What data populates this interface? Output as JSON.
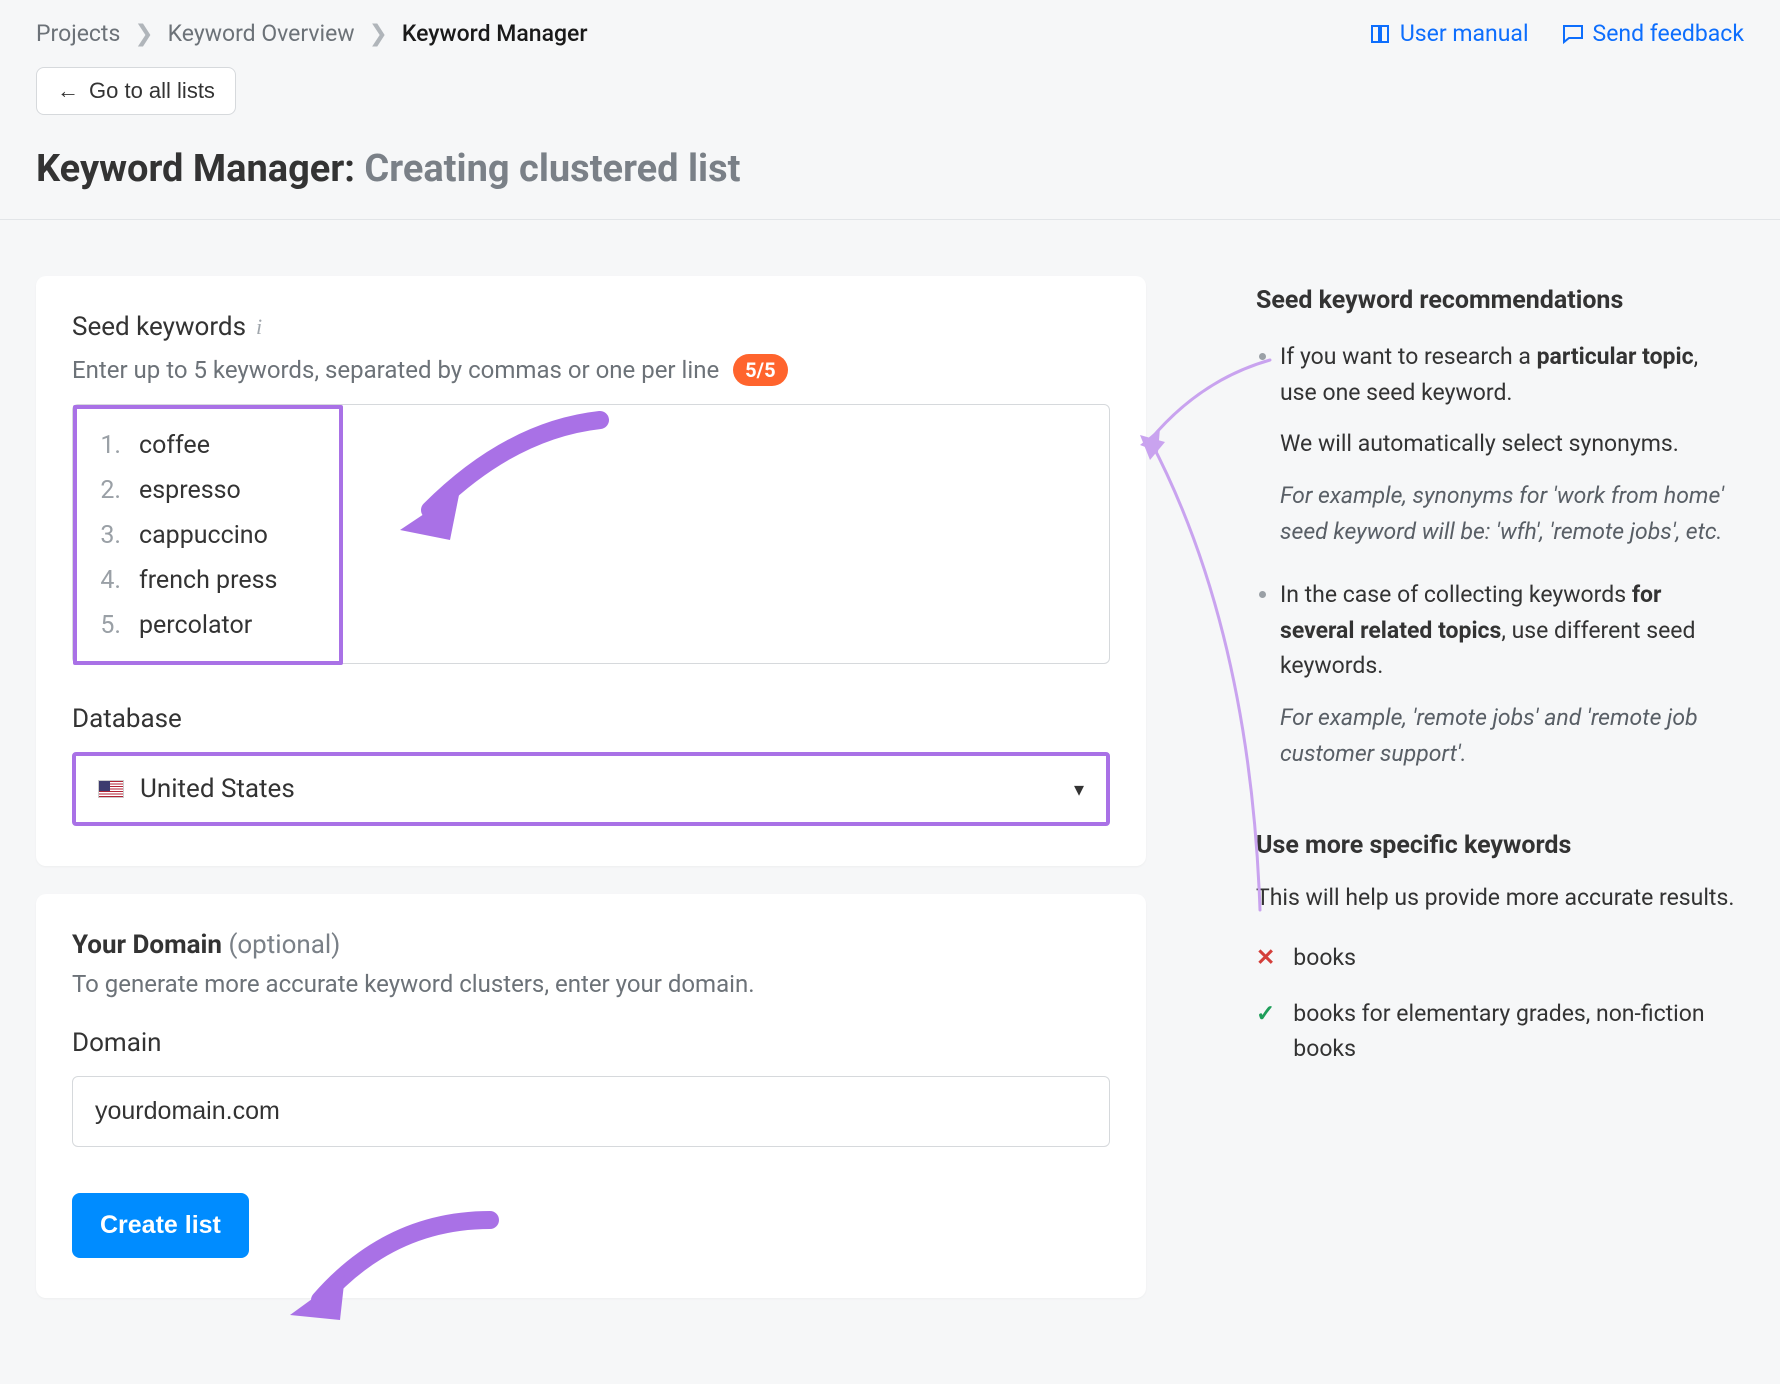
{
  "breadcrumb": {
    "projects": "Projects",
    "overview": "Keyword Overview",
    "current": "Keyword Manager"
  },
  "header_links": {
    "manual": "User manual",
    "feedback": "Send feedback"
  },
  "back_button": "Go to all lists",
  "page_title": {
    "main": "Keyword Manager:",
    "sub": "Creating clustered list"
  },
  "seed": {
    "label": "Seed keywords",
    "hint": "Enter up to 5 keywords, separated by commas or one per line",
    "badge": "5/5",
    "keywords": [
      "coffee",
      "espresso",
      "cappuccino",
      "french press",
      "percolator"
    ]
  },
  "database": {
    "label": "Database",
    "selected": "United States"
  },
  "domain": {
    "title": "Your Domain",
    "optional": "(optional)",
    "desc": "To generate more accurate keyword clusters, enter your domain.",
    "label": "Domain",
    "value": "yourdomain.com"
  },
  "create_button": "Create list",
  "reco": {
    "title": "Seed keyword recommendations",
    "item1_a": "If you want to research a ",
    "item1_b": "particular topic",
    "item1_c": ", use one seed keyword.",
    "item1_p": "We will automatically select synonyms.",
    "item1_ex": "For example, synonyms for 'work from home' seed keyword will be: 'wfh', 'remote jobs', etc.",
    "item2_a": "In the case of collecting keywords ",
    "item2_b": "for several related topics",
    "item2_c": ", use different seed keywords.",
    "item2_ex": "For example, 'remote jobs' and 'remote job customer support'."
  },
  "tips": {
    "title": "Use more specific keywords",
    "desc": "This will help us provide more accurate results.",
    "bad": "books",
    "good": "books for elementary grades, non-fiction books"
  }
}
